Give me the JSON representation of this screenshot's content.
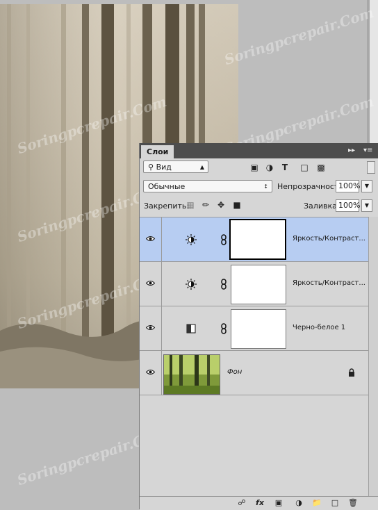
{
  "watermark": {
    "text": "Soringpcrepair.Com"
  },
  "panel": {
    "tab_label": "Слои",
    "collapse_icon": "double-arrow-right-icon",
    "menu_icon": "panel-menu-icon"
  },
  "filter": {
    "kind_label": "Вид",
    "filter_icons": [
      "image-filter-icon",
      "adjustment-filter-icon",
      "type-filter-icon",
      "shape-filter-icon",
      "smart-object-filter-icon"
    ]
  },
  "blend": {
    "mode_label": "Обычные",
    "opacity_label": "Непрозрачность:",
    "opacity_value": "100%"
  },
  "lock": {
    "label": "Закрепить:",
    "fill_label": "Заливка:",
    "fill_value": "100%"
  },
  "layers": [
    {
      "name": "Яркость/Контраст...",
      "type": "brightness-contrast",
      "selected": true
    },
    {
      "name": "Яркость/Контраст...",
      "type": "brightness-contrast",
      "selected": false
    },
    {
      "name": "Черно-белое 1",
      "type": "black-white",
      "selected": false
    },
    {
      "name": "Фон",
      "type": "background",
      "locked": true,
      "selected": false
    }
  ],
  "footer_icons": [
    "link-layers-icon",
    "fx-icon",
    "add-mask-icon",
    "new-adjustment-icon",
    "new-group-icon",
    "new-layer-icon",
    "delete-layer-icon"
  ],
  "footer": {
    "fx_label": "fx"
  },
  "colors": {
    "selected_row": "#b7cdf2",
    "panel_bg": "#d6d6d6",
    "tab_bar": "#4d4d4d"
  }
}
